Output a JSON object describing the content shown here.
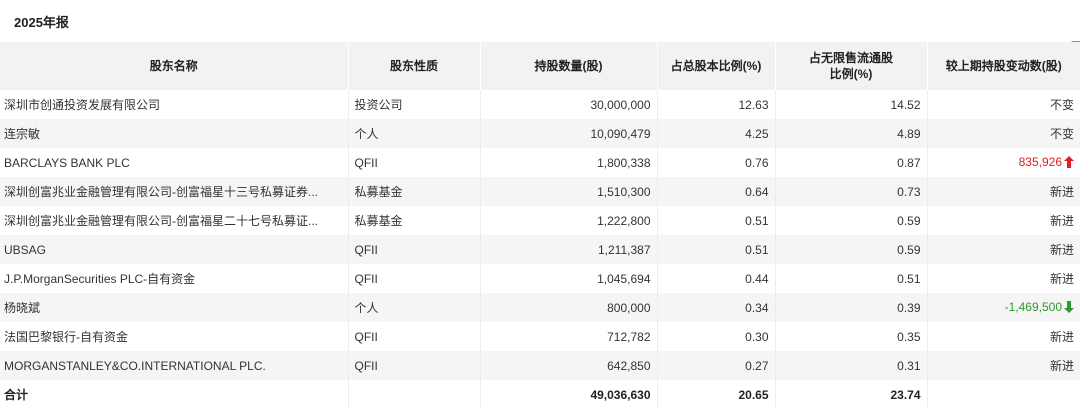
{
  "period_title": "2025年报",
  "headers": {
    "name": "股东名称",
    "type": "股东性质",
    "shares": "持股数量(股)",
    "pct_total": "占总股本比例(%)",
    "pct_float": "占无限售流通股比例(%)",
    "change": "较上期持股变动数(股)"
  },
  "rows": [
    {
      "name": "深圳市创通投资发展有限公司",
      "type": "投资公司",
      "shares": "30,000,000",
      "pct_total": "12.63",
      "pct_float": "14.52",
      "change": "不变"
    },
    {
      "name": "连宗敏",
      "type": "个人",
      "shares": "10,090,479",
      "pct_total": "4.25",
      "pct_float": "4.89",
      "change": "不变"
    },
    {
      "name": "BARCLAYS BANK PLC",
      "type": "QFII",
      "shares": "1,800,338",
      "pct_total": "0.76",
      "pct_float": "0.87",
      "change": "835,926",
      "direction": "up"
    },
    {
      "name": "深圳创富兆业金融管理有限公司-创富福星十三号私募证券...",
      "type": "私募基金",
      "shares": "1,510,300",
      "pct_total": "0.64",
      "pct_float": "0.73",
      "change": "新进"
    },
    {
      "name": "深圳创富兆业金融管理有限公司-创富福星二十七号私募证...",
      "type": "私募基金",
      "shares": "1,222,800",
      "pct_total": "0.51",
      "pct_float": "0.59",
      "change": "新进"
    },
    {
      "name": "UBSAG",
      "type": "QFII",
      "shares": "1,211,387",
      "pct_total": "0.51",
      "pct_float": "0.59",
      "change": "新进"
    },
    {
      "name": "J.P.MorganSecurities PLC-自有资金",
      "type": "QFII",
      "shares": "1,045,694",
      "pct_total": "0.44",
      "pct_float": "0.51",
      "change": "新进"
    },
    {
      "name": "杨晓斌",
      "type": "个人",
      "shares": "800,000",
      "pct_total": "0.34",
      "pct_float": "0.39",
      "change": "-1,469,500",
      "direction": "down"
    },
    {
      "name": "法国巴黎银行-自有资金",
      "type": "QFII",
      "shares": "712,782",
      "pct_total": "0.30",
      "pct_float": "0.35",
      "change": "新进"
    },
    {
      "name": "MORGANSTANLEY&CO.INTERNATIONAL PLC.",
      "type": "QFII",
      "shares": "642,850",
      "pct_total": "0.27",
      "pct_float": "0.31",
      "change": "新进"
    }
  ],
  "total": {
    "label": "合计",
    "shares": "49,036,630",
    "pct_total": "20.65",
    "pct_float": "23.74"
  },
  "colors": {
    "up": "#e02020",
    "down": "#2e9a2e",
    "header_bg": "#f2f2f2",
    "accent": "#f0772f"
  },
  "icons": {
    "up": "arrow-up-icon",
    "down": "arrow-down-icon"
  }
}
